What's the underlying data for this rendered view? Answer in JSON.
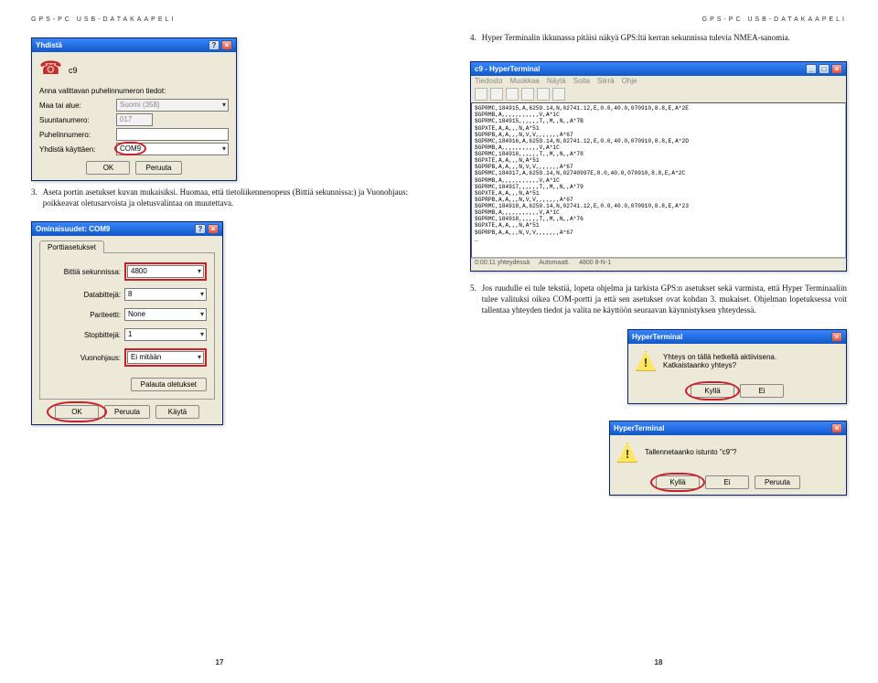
{
  "headerText": "GPS-PC USB-DATAKAAPELI",
  "leftPage": {
    "num": "17",
    "item3": {
      "n": "3.",
      "text": "Aseta portin asetukset kuvan mukaisiksi. Huomaa, että tietoliikennenopeus (Bittiä sekunnissa:) ja Vuonohjaus: poikkeavat oletusarvoista ja oletusvalintaa on muutettava."
    },
    "dlgConnect": {
      "title": "Yhdistä",
      "name": "c9",
      "subtitle": "Anna valittavan puhelinnumeron tiedot:",
      "countryLbl": "Maa tai alue:",
      "countryVal": "Suomi (358)",
      "areaLbl": "Suuntanumero:",
      "areaVal": "017",
      "phoneLbl": "Puhelinnumero:",
      "connectLbl": "Yhdistä käyttäen:",
      "connectVal": "COM9",
      "ok": "OK",
      "cancel": "Peruuta"
    },
    "dlgProps": {
      "title": "Ominaisuudet: COM9",
      "tab": "Porttiasetukset",
      "bpsLbl": "Bittiä sekunnissa:",
      "bpsVal": "4800",
      "dataLbl": "Databittejä:",
      "dataVal": "8",
      "parityLbl": "Pariteetti:",
      "parityVal": "None",
      "stopLbl": "Stopbittejä:",
      "stopVal": "1",
      "flowLbl": "Vuonohjaus:",
      "flowVal": "Ei mitään",
      "restore": "Palauta oletukset",
      "ok": "OK",
      "cancel": "Peruuta",
      "apply": "Käytä"
    }
  },
  "rightPage": {
    "num": "18",
    "item4": {
      "n": "4.",
      "text": "Hyper Terminalin ikkunassa pitäisi näkyä GPS:ltä kerran sekunnissa tulevia NMEA-sanomia."
    },
    "item5": {
      "n": "5.",
      "text": "Jos ruudulle ei tule tekstiä, lopeta ohjelma ja tarkista GPS:n asetukset sekä varmista, että Hyper Terminaaliin tulee valituksi oikea COM-portti ja että sen asetukset ovat kohdan 3. mukaiset. Ohjelman lopetuksessa voit tallentaa yhteyden tiedot ja valita ne käyttöön seuraavan käynnistyksen yhteydessä."
    },
    "ht": {
      "title": "c9 - HyperTerminal",
      "menu": [
        "Tiedosto",
        "Muokkaa",
        "Näytä",
        "Soita",
        "Siirrä",
        "Ohje"
      ],
      "lines": [
        "$GPRMC,184915,A,6259.14,N,02741.12,E,0.0,40.0,070910,8.8,E,A*2E",
        "$GPRMB,A,,,,,,,,,,,V,A*1C",
        "$GPRMC,184915,,,,,,T,,M,,N,,A*7B",
        "$GPXTE,A,A,,,N,A*51",
        "$GPRPB,A,A,,,N,V,V,,,,,,,A*67",
        "$GPRMC,184916,A,6259.14,N,02741.12,E,0.0,40.0,070910,8.8,E,A*2D",
        "$GPRMB,A,,,,,,,,,,,V,A*1C",
        "$GPRMC,184916,,,,,,T,,M,,N,,A*78",
        "$GPXTE,A,A,,,N,A*51",
        "$GPRPB,A,A,,,N,V,V,,,,,,,A*67",
        "$GPRMC,184917,A,6259.14,N,02740997E,0.0,40.0,070910,8.8,E,A*2C",
        "$GPRMB,A,,,,,,,,,,,V,A*1C",
        "$GPRMC,184917,,,,,,T,,M,,N,,A*79",
        "$GPXTE,A,A,,,N,A*51",
        "$GPRPB,A,A,,,N,V,V,,,,,,,A*67",
        "$GPRMC,184918,A,6259.14,N,02741.12,E,0.0,40.0,070910,8.8,E,A*23",
        "$GPRMB,A,,,,,,,,,,,V,A*1C",
        "$GPRMC,184918,,,,,,T,,M,,N,,A*76",
        "$GPXTE,A,A,,,N,A*51",
        "$GPRPB,A,A,,,N,V,V,,,,,,,A*67",
        "_"
      ],
      "status": [
        "0:00:11 yhteydessä",
        "Automaatt.",
        "4800 8-N-1"
      ]
    },
    "msg1": {
      "title": "HyperTerminal",
      "line1": "Yhteys on tällä hetkellä aktiivisena.",
      "line2": "Katkaistaanko yhteys?",
      "yes": "Kyllä",
      "no": "Ei"
    },
    "msg2": {
      "title": "HyperTerminal",
      "line1": "Tallennetaanko istunto \"c9\"?",
      "yes": "Kyllä",
      "no": "Ei",
      "cancel": "Peruuta"
    }
  }
}
